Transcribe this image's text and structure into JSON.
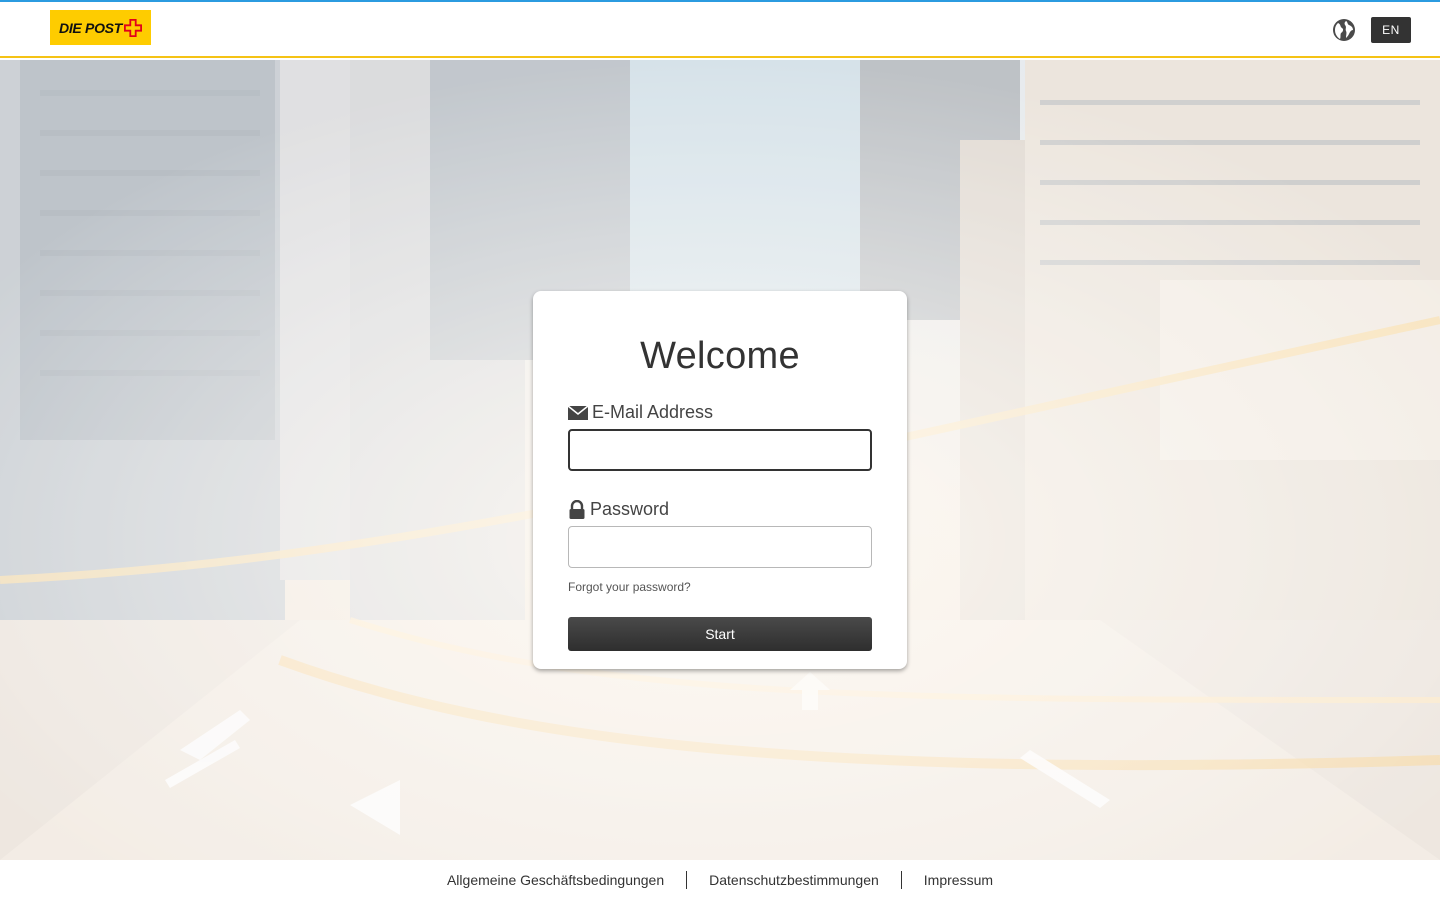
{
  "header": {
    "logo_text": "DIE POST",
    "language_label": "EN"
  },
  "login": {
    "title": "Welcome",
    "email_label": "E-Mail Address",
    "email_value": "",
    "password_label": "Password",
    "password_value": "",
    "forgot_password": "Forgot your password?",
    "start_button": "Start"
  },
  "footer": {
    "links": [
      {
        "label": "Allgemeine Geschäftsbedingungen"
      },
      {
        "label": "Datenschutzbestimmungen"
      },
      {
        "label": "Impressum"
      }
    ]
  },
  "colors": {
    "accent_blue": "#2b9be0",
    "brand_yellow": "#fecc00",
    "header_border": "#f5c315",
    "button_dark": "#333333"
  },
  "icons": {
    "logo_cross": "swiss-cross-icon",
    "globe": "globe-icon",
    "email": "envelope-icon",
    "password": "lock-icon"
  }
}
